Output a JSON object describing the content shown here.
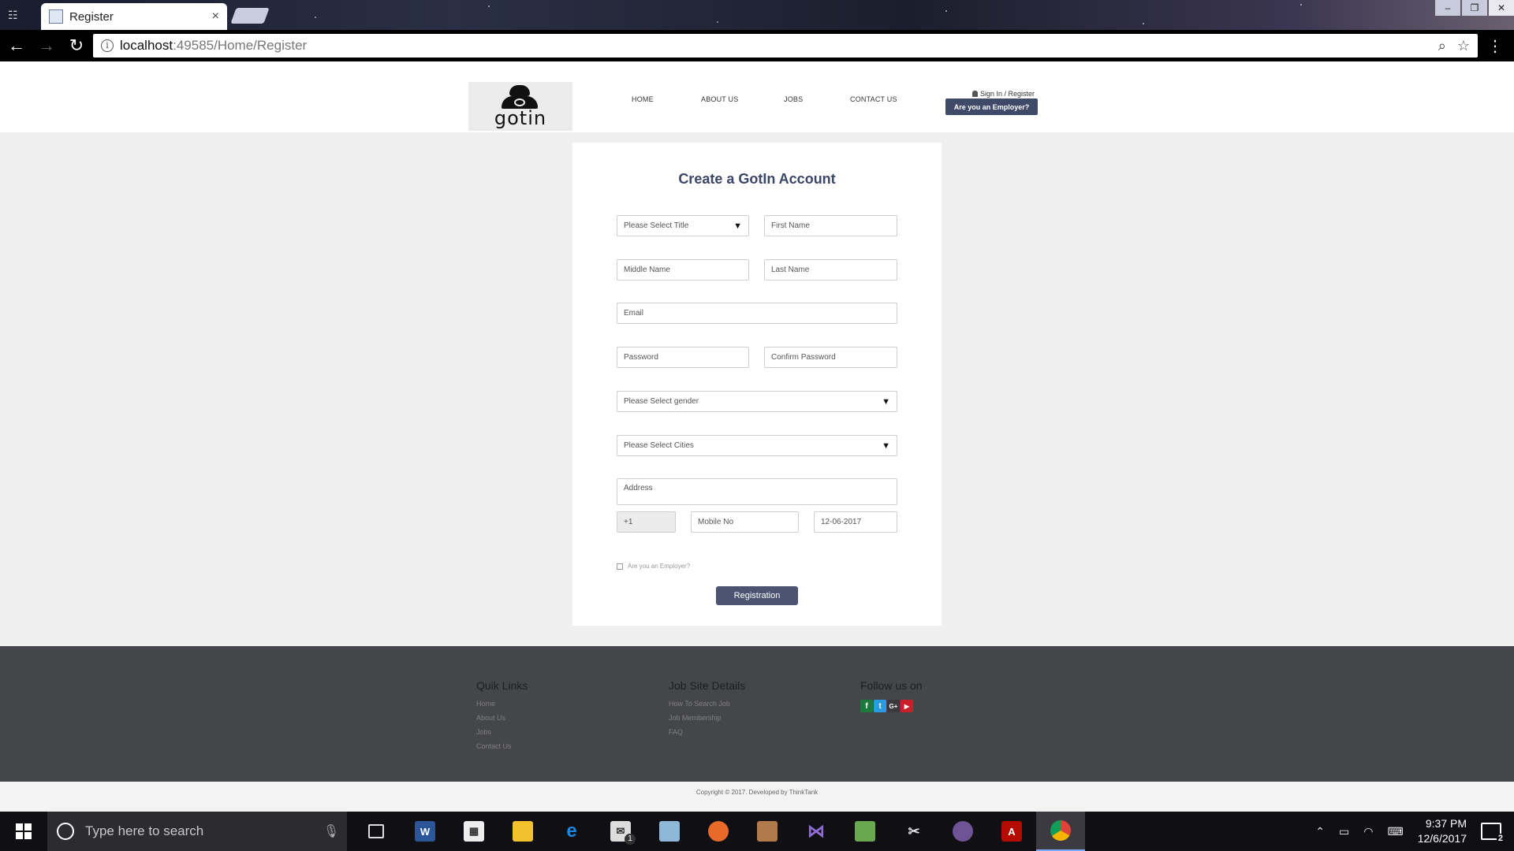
{
  "browser": {
    "tab_title": "Register",
    "tab_close": "×",
    "url_host": "localhost",
    "url_path": ":49585/Home/Register",
    "window_controls": [
      "–",
      "❐",
      "✕"
    ]
  },
  "site": {
    "logo_text": "gotin",
    "nav": [
      "HOME",
      "ABOUT US",
      "JOBS",
      "CONTACT US"
    ],
    "signin_label": "Sign In / Register",
    "employer_button": "Are you an Employer?"
  },
  "form": {
    "title": "Create a GotIn Account",
    "title_select": "Please Select Title",
    "first_name": "First Name",
    "middle_name": "Middle Name",
    "last_name": "Last Name",
    "email": "Email",
    "password": "Password",
    "confirm_password": "Confirm Password",
    "gender_select": "Please Select gender",
    "cities_select": "Please Select Cities",
    "address": "Address",
    "country_code": "+1",
    "mobile": "Mobile No",
    "date": "12-06-2017",
    "employer_checkbox": "Are you an Employer?",
    "submit": "Registration"
  },
  "footer": {
    "col1": {
      "heading": "Quik Links",
      "links": [
        "Home",
        "About Us",
        "Jobs",
        "Contact Us"
      ]
    },
    "col2": {
      "heading": "Job Site Details",
      "links": [
        "How To Search Job",
        "Job Membership",
        "FAQ"
      ]
    },
    "col3": {
      "heading": "Follow us on",
      "icons": [
        "f",
        "t",
        "G+",
        "▶"
      ]
    },
    "copyright": "Copyright © 2017. Developed by ThinkTank"
  },
  "taskbar": {
    "search_placeholder": "Type here to search",
    "time": "9:37 PM",
    "date": "12/6/2017",
    "mail_badge": "1",
    "notification_count": "2"
  },
  "colors": {
    "accent": "#3f4a68",
    "footer_bg": "#454649",
    "page_bg": "#efefef"
  }
}
